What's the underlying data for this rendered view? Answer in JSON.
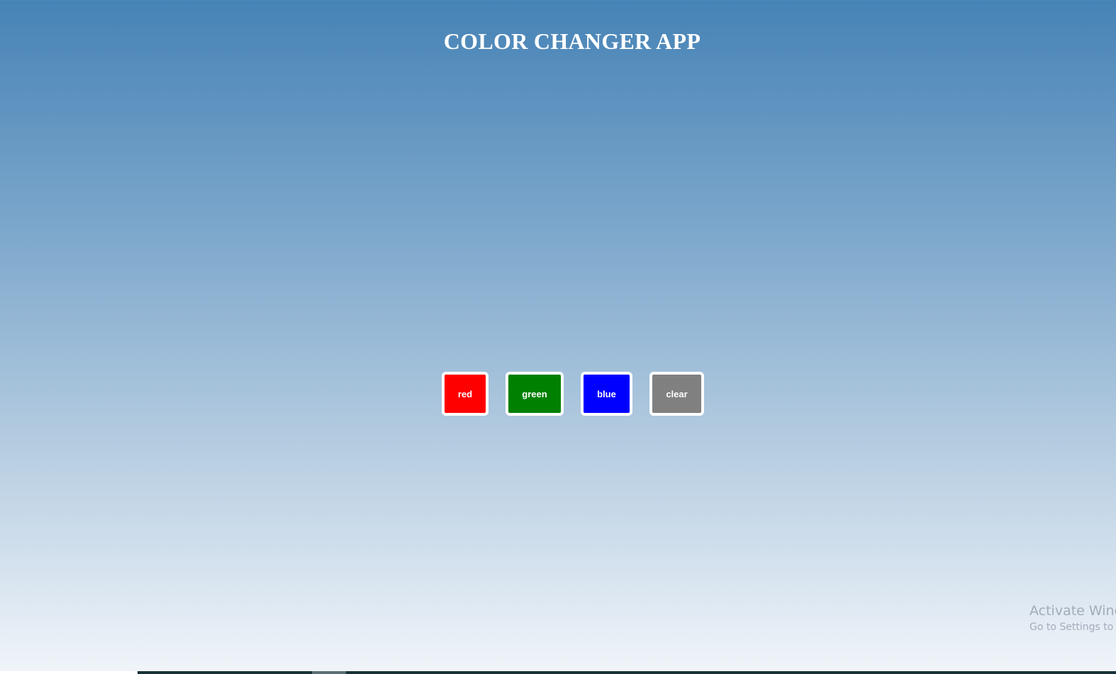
{
  "page": {
    "title": "COLOR CHANGER APP"
  },
  "buttons": [
    {
      "label": "red",
      "color": "#ff0000"
    },
    {
      "label": "green",
      "color": "#008000"
    },
    {
      "label": "blue",
      "color": "#0000ff"
    },
    {
      "label": "clear",
      "color": "#808080"
    }
  ],
  "watermark": {
    "line1": "Activate Windows",
    "line2": "Go to Settings to activate Windows."
  }
}
